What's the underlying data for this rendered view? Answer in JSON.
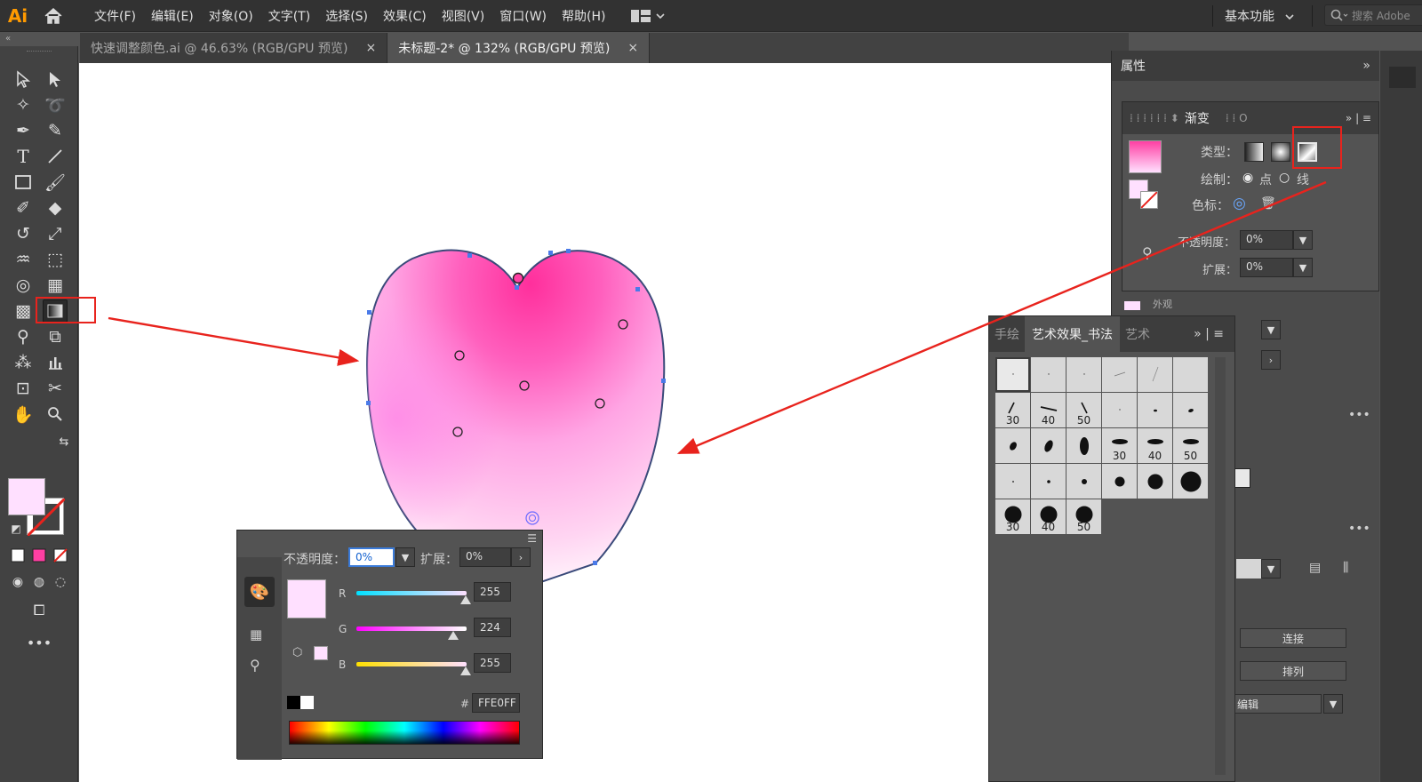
{
  "app": {
    "logo": "Ai"
  },
  "menu": [
    "文件(F)",
    "编辑(E)",
    "对象(O)",
    "文字(T)",
    "选择(S)",
    "效果(C)",
    "视图(V)",
    "窗口(W)",
    "帮助(H)"
  ],
  "workspace": "基本功能",
  "search": {
    "placeholder": "搜索 Adobe"
  },
  "tabs": [
    {
      "label": "快速调整颜色.ai @ 46.63% (RGB/GPU 预览)",
      "active": false
    },
    {
      "label": "未标题-2* @ 132% (RGB/GPU 预览)",
      "active": true
    }
  ],
  "tab_close": "×",
  "properties": {
    "title": "属性",
    "small_label": "外观"
  },
  "gradient": {
    "tab_label": "渐变",
    "type_label": "类型：",
    "draw_label": "绘制：",
    "draw_point": "点",
    "draw_line": "线",
    "stop_label": "色标：",
    "opacity_label": "不透明度：",
    "opacity_value": "0%",
    "extend_label": "扩展：",
    "extend_value": "0%"
  },
  "brushes": {
    "tabs": [
      "手绘",
      "艺术效果_书法",
      "艺术"
    ],
    "active_tab": "艺术效果_书法",
    "cells": [
      "",
      "",
      "",
      "",
      "",
      "",
      "30",
      "40",
      "50",
      "",
      "",
      "",
      "",
      "",
      "",
      "30",
      "40",
      "50",
      "",
      "",
      "",
      "",
      "",
      "",
      "30",
      "40",
      "50"
    ]
  },
  "color": {
    "opacity_label": "不透明度：",
    "opacity_value": "0%",
    "extend_label": "扩展：",
    "extend_value": "0%",
    "r_label": "R",
    "r_value": "255",
    "g_label": "G",
    "g_value": "224",
    "b_label": "B",
    "b_value": "255",
    "hex_prefix": "#",
    "hex_value": "FFE0FF",
    "swatch_color": "#ffe0ff"
  },
  "right_buttons": {
    "connect": "连接",
    "arrange": "排列",
    "edit": "编辑"
  },
  "colors": {
    "fill": "#ffe0ff",
    "heart_top": "#ff3fa3",
    "annotation": "#e8231d"
  }
}
